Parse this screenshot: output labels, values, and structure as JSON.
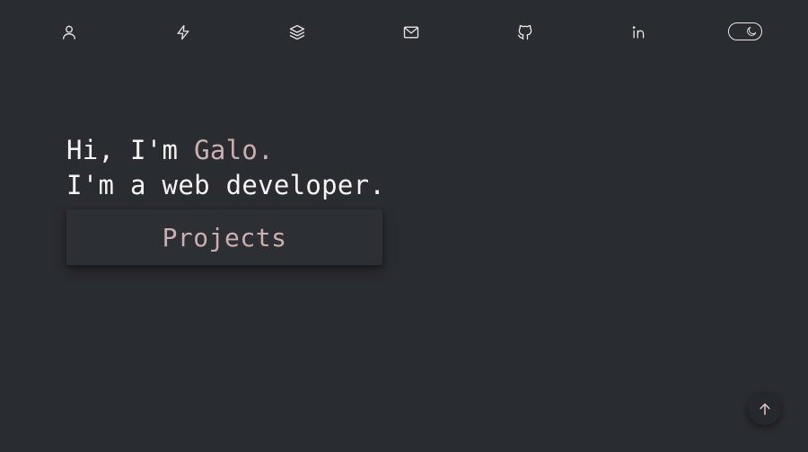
{
  "nav": {
    "items": [
      {
        "icon": "user-icon",
        "name": "nav-about"
      },
      {
        "icon": "lightning-icon",
        "name": "nav-skills"
      },
      {
        "icon": "layers-icon",
        "name": "nav-projects"
      },
      {
        "icon": "mail-icon",
        "name": "nav-contact"
      },
      {
        "icon": "github-icon",
        "name": "nav-github"
      },
      {
        "icon": "linkedin-icon",
        "name": "nav-linkedin"
      }
    ],
    "theme_toggle": {
      "icon": "moon-icon",
      "mode": "dark"
    }
  },
  "hero": {
    "greeting_prefix": "Hi, I'm ",
    "name": "Galo.",
    "tagline": "I'm a web developer."
  },
  "projects_button": {
    "label": "Projects"
  },
  "scroll_top": {
    "icon": "arrow-up-icon"
  },
  "colors": {
    "background": "#292c31",
    "text": "#f4f4f4",
    "accent": "#cbaeae",
    "icon": "#e6e6e6"
  }
}
